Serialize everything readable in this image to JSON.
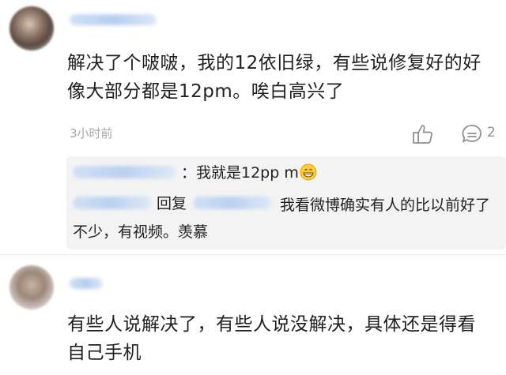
{
  "comments": [
    {
      "text": "解决了个啵啵，我的12依旧绿，有些说修复好的好像大部分都是12pm。唉白高兴了",
      "time": "3小时前",
      "reply_count": "2",
      "icons": {
        "like": "thumbs-up-icon",
        "reply": "comment-bubble-icon"
      },
      "replies": [
        {
          "text": "：我就是12pp m",
          "emoji": "grinning-face-icon"
        },
        {
          "reply_label": "回复",
          "text": "我看微博确实有人的比以前好了不少，有视频。羡慕"
        }
      ]
    },
    {
      "text": "有些人说解决了，有些人说没解决，具体还是得看自己手机"
    }
  ],
  "colors": {
    "background": "#ffffff",
    "sub_box": "#f3f3f3",
    "meta_text": "#a6a6a6",
    "username_blur": "#b5cdef"
  }
}
